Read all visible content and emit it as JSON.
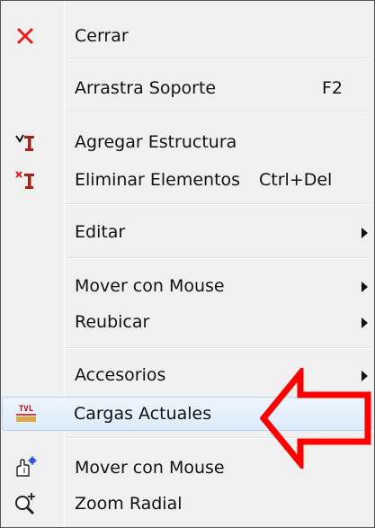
{
  "menu": {
    "items": [
      {
        "label": "Cerrar",
        "icon": "close-x-icon"
      },
      {
        "label": "Arrastra Soporte",
        "shortcut": "F2"
      },
      {
        "label": "Agregar Estructura",
        "icon": "add-structure-icon"
      },
      {
        "label": "Eliminar Elementos",
        "shortcut": "Ctrl+Del",
        "icon": "delete-elements-icon"
      },
      {
        "label": "Editar",
        "submenu": true
      },
      {
        "label": "Mover con Mouse",
        "submenu": true
      },
      {
        "label": "Reubicar",
        "submenu": true
      },
      {
        "label": "Accesorios",
        "submenu": true
      },
      {
        "label": "Cargas Actuales",
        "icon": "current-loads-icon",
        "highlighted": true
      },
      {
        "label": "Mover con Mouse",
        "icon": "move-mouse-icon"
      },
      {
        "label": "Zoom Radial",
        "icon": "zoom-radial-icon"
      }
    ]
  },
  "icons": {
    "close_color": "#e81e1e",
    "loads_glyph_text": "TVL"
  },
  "annotation": {
    "arrow_color": "#ff0000"
  }
}
